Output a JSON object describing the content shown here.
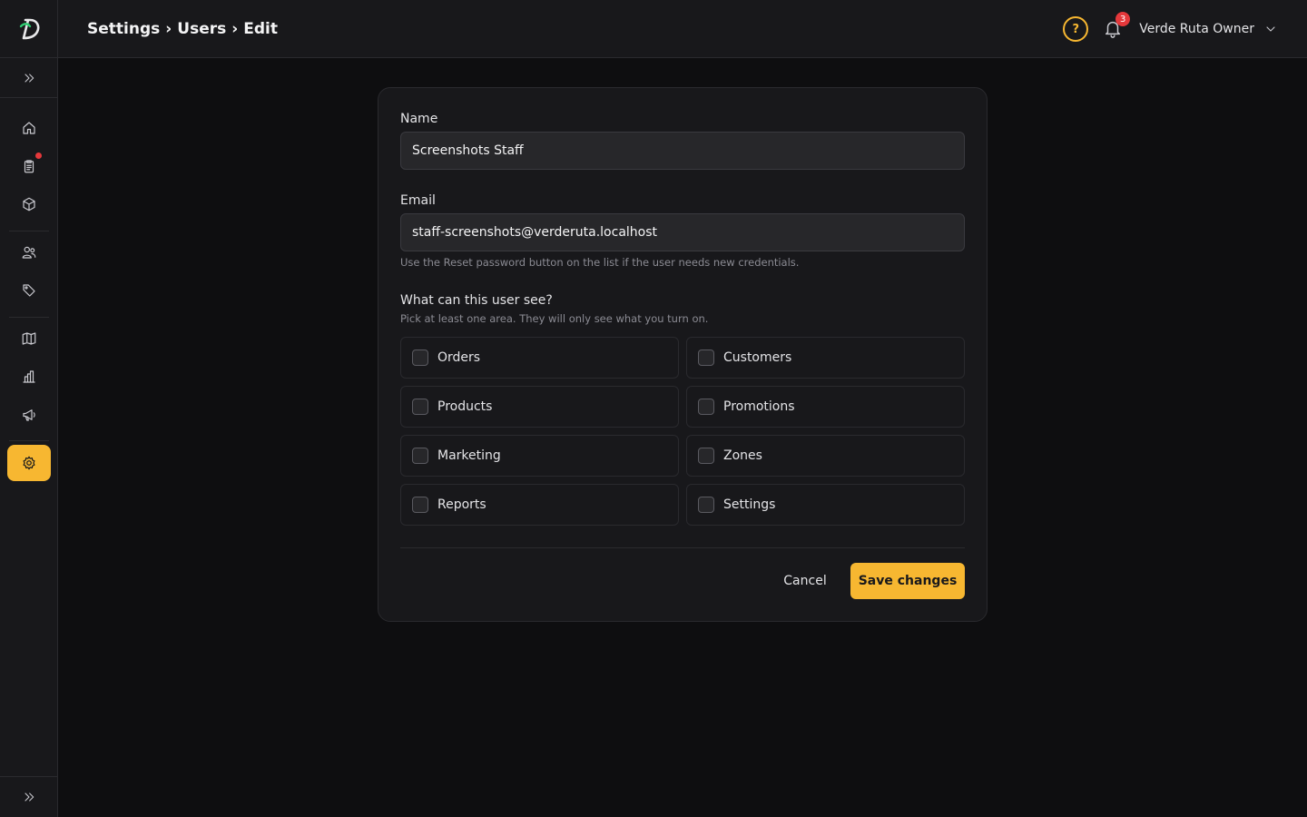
{
  "header": {
    "breadcrumb": [
      "Settings",
      "Users",
      "Edit"
    ],
    "separator": "›",
    "notification_count": "3",
    "user_name": "Verde Ruta Owner",
    "logo_letter": "D"
  },
  "sidebar": {
    "items": [
      {
        "name": "home-icon",
        "active": false
      },
      {
        "name": "orders-icon",
        "active": false,
        "has_dot": true
      },
      {
        "name": "box-icon",
        "active": false
      },
      {
        "name": "users-icon",
        "active": false
      },
      {
        "name": "tag-icon",
        "active": false
      },
      {
        "name": "map-icon",
        "active": false
      },
      {
        "name": "chart-icon",
        "active": false
      },
      {
        "name": "megaphone-icon",
        "active": false
      },
      {
        "name": "gear-icon",
        "active": true
      }
    ]
  },
  "form": {
    "name_label": "Name",
    "name_value": "Screenshots Staff",
    "email_label": "Email",
    "email_value": "staff-screenshots@verderuta.localhost",
    "email_hint": "Use the Reset password button on the list if the user needs new credentials.",
    "permissions_title": "What can this user see?",
    "permissions_hint": "Pick at least one area. They will only see what you turn on.",
    "permissions": [
      {
        "label": "Orders",
        "checked": false
      },
      {
        "label": "Customers",
        "checked": false
      },
      {
        "label": "Products",
        "checked": false
      },
      {
        "label": "Promotions",
        "checked": false
      },
      {
        "label": "Marketing",
        "checked": false
      },
      {
        "label": "Zones",
        "checked": false
      },
      {
        "label": "Reports",
        "checked": false
      },
      {
        "label": "Settings",
        "checked": false
      }
    ],
    "cancel_label": "Cancel",
    "save_label": "Save changes"
  },
  "colors": {
    "accent": "#f7b731",
    "badge": "#e5383b",
    "background": "#0e0e10",
    "panel": "#18181b"
  }
}
